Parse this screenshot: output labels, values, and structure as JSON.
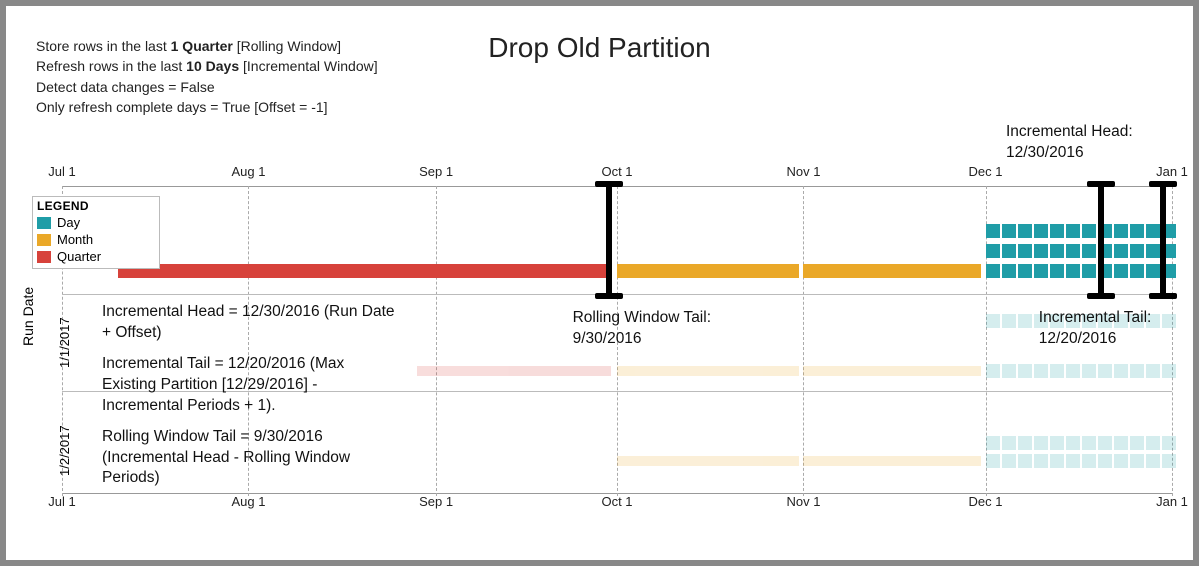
{
  "title": "Drop Old Partition",
  "settings": {
    "line1a": "Store rows in the last ",
    "line1b": "1 Quarter",
    "line1c": " [Rolling Window]",
    "line2a": "Refresh rows in the last ",
    "line2b": "10 Days",
    "line2c": " [Incremental Window]",
    "line3": "Detect data changes = False",
    "line4": "Only refresh complete days = True [Offset = -1]"
  },
  "legend": {
    "title": "LEGEND",
    "day": "Day",
    "month": "Month",
    "quarter": "Quarter"
  },
  "axis": {
    "jul": "Jul 1",
    "aug": "Aug 1",
    "sep": "Sep 1",
    "oct": "Oct 1",
    "nov": "Nov 1",
    "dec": "Dec 1",
    "jan": "Jan 1"
  },
  "y": {
    "title": "Run Date",
    "r1": "1/1/2017",
    "r2": "1/2/2017"
  },
  "callouts": {
    "inc_head_top": "Incremental Head:\n12/30/2016",
    "rolling_tail": "Rolling Window Tail:\n9/30/2016",
    "inc_tail": "Incremental Tail:\n12/20/2016"
  },
  "explain": {
    "p1": "Incremental Head = 12/30/2016 (Run Date + Offset)",
    "p2": "Incremental Tail = 12/20/2016 (Max Existing Partition [12/29/2016] - Incremental Periods + 1).",
    "p3": "Rolling Window Tail = 9/30/2016 (Incremental Head - Rolling Window Periods)"
  },
  "chart_data": {
    "type": "timeline",
    "x_axis_ticks": [
      "Jul 1",
      "Aug 1",
      "Sep 1",
      "Oct 1",
      "Nov 1",
      "Dec 1",
      "Jan 1"
    ],
    "x_range": [
      "2016-07-01",
      "2017-01-01"
    ],
    "y_title": "Run Date",
    "run_dates": [
      "1/1/2017",
      "1/2/2017"
    ],
    "series": [
      {
        "name": "Quarter",
        "color": "#d7423b",
        "range": [
          "2016-07-01",
          "2016-09-30"
        ],
        "row": "main"
      },
      {
        "name": "Month",
        "color": "#eaa828",
        "range": [
          "2016-10-01",
          "2016-11-30"
        ],
        "row": "main",
        "segments": 2
      },
      {
        "name": "Day",
        "color": "#1f9da7",
        "range": [
          "2016-12-01",
          "2016-12-30"
        ],
        "row": "main",
        "count": 30
      }
    ],
    "markers": {
      "rolling_window_tail": "2016-09-30",
      "incremental_tail": "2016-12-20",
      "incremental_head": "2016-12-30"
    },
    "colors": {
      "day": "#1f9da7",
      "month": "#eaa828",
      "quarter": "#d7423b"
    }
  }
}
